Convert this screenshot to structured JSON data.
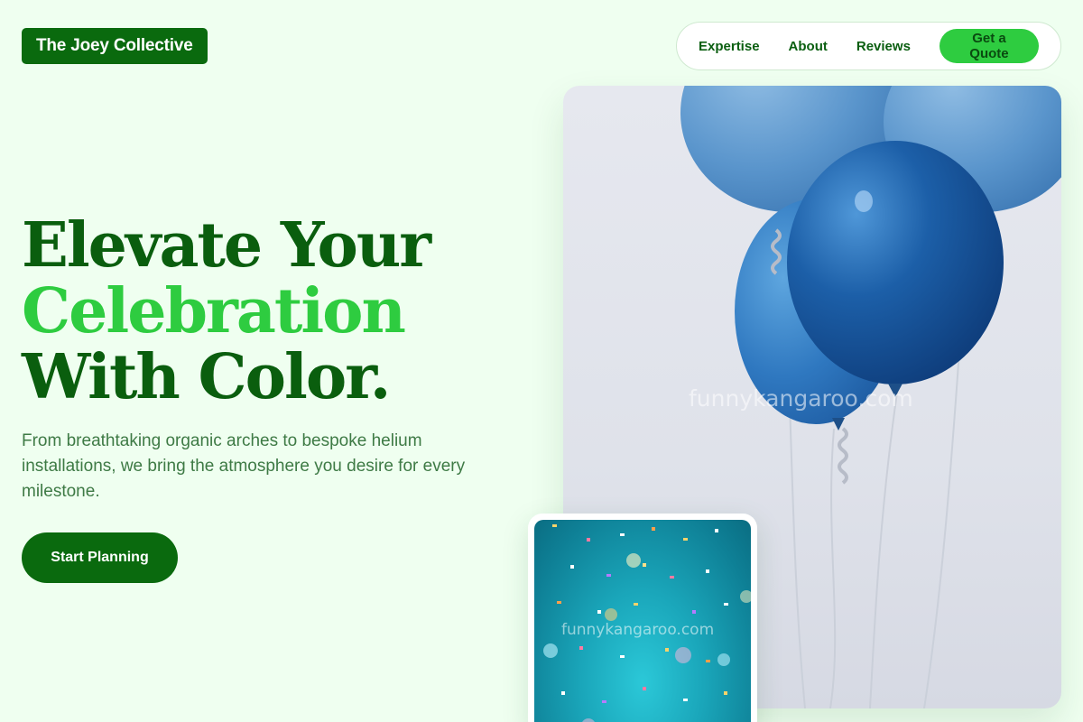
{
  "brand": {
    "name": "The Joey Collective"
  },
  "nav": {
    "items": [
      "Expertise",
      "About",
      "Reviews"
    ],
    "cta_label": "Get a Quote"
  },
  "hero": {
    "line1": "Elevate Your",
    "line2": "Celebration",
    "line3": "With Color.",
    "subtext": "From breathtaking organic arches to bespoke helium installations, we bring the atmosphere you desire for every milestone.",
    "cta_label": "Start Planning"
  },
  "images": {
    "main_watermark": "funnykangaroo.com",
    "secondary_watermark": "funnykangaroo.com"
  },
  "colors": {
    "background": "#effff0",
    "primary_dark_green": "#0a6a0e",
    "accent_green": "#2ecc40",
    "body_text": "#3e7a45"
  }
}
